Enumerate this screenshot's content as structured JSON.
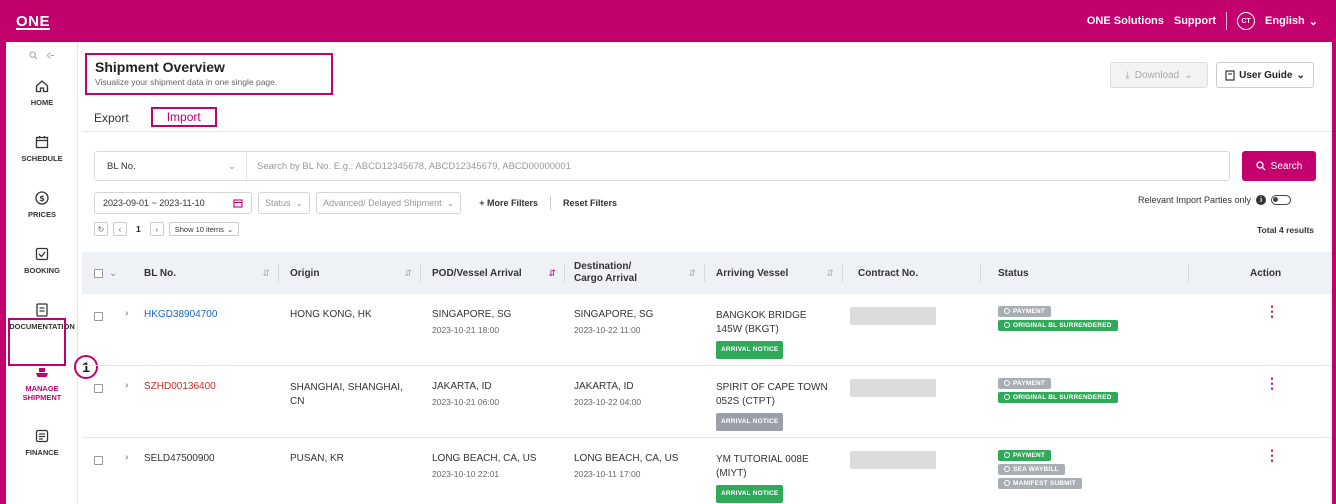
{
  "app": {
    "logo": "ONE",
    "top_links": {
      "solutions": "ONE Solutions",
      "support": "Support",
      "avatar": "CT",
      "language": "English"
    }
  },
  "sidebar": {
    "items": [
      {
        "label": "HOME",
        "icon": "home-icon"
      },
      {
        "label": "SCHEDULE",
        "icon": "calendar-icon"
      },
      {
        "label": "PRICES",
        "icon": "dollar-icon"
      },
      {
        "label": "BOOKING",
        "icon": "booking-icon"
      },
      {
        "label": "DOCUMENTATION",
        "icon": "document-icon"
      },
      {
        "label": "MANAGE SHIPMENT",
        "icon": "ship-icon",
        "active": true
      },
      {
        "label": "FINANCE",
        "icon": "finance-icon"
      }
    ],
    "step_marker": "1"
  },
  "header": {
    "title": "Shipment Overview",
    "subtitle": "Visualize your shipment data in one single page.",
    "download_label": "Download",
    "user_guide_label": "User Guide"
  },
  "tabs": [
    {
      "label": "Export"
    },
    {
      "label": "Import",
      "active": true
    }
  ],
  "search": {
    "field_select": "BL No.",
    "placeholder": "Search by BL No. E.g.: ABCD12345678, ABCD12345679, ABCD00000001",
    "button_label": "Search"
  },
  "filters": {
    "date_range": "2023-09-01 ~ 2023-11-10",
    "status": "Status",
    "advanced": "Advanced/ Delayed Shipment",
    "more_filters": "+ More Filters",
    "reset_filters": "Reset Filters",
    "relevant_toggle_label": "Relevant Import Parties only"
  },
  "pager": {
    "page": "1",
    "show_items": "Show 10 items",
    "total": "Total 4 results"
  },
  "table": {
    "columns": {
      "bl": "BL No.",
      "origin": "Origin",
      "pod": "POD/Vessel Arrival",
      "dest": "Destination/ Cargo Arrival",
      "vessel": "Arriving Vessel",
      "contract": "Contract No.",
      "status": "Status",
      "action": "Action"
    },
    "rows": [
      {
        "bl": "HKGD38904700",
        "bl_style": "link",
        "origin": "HONG KONG, HK",
        "pod": "SINGAPORE, SG",
        "pod_time": "2023-10-21  18:00",
        "dest": "SINGAPORE, SG",
        "dest_time": "2023-10-22  11:00",
        "vessel": "BANGKOK BRIDGE 145W (BKGT)",
        "vessel_chip": "ARRIVAL NOTICE",
        "statuses": [
          {
            "label": "PAYMENT",
            "color": "grey"
          },
          {
            "label": "ORIGINAL BL SURRENDERED",
            "color": "green"
          }
        ]
      },
      {
        "bl": "SZHD00136400",
        "bl_style": "red",
        "origin": "SHANGHAI, SHANGHAI, CN",
        "pod": "JAKARTA, ID",
        "pod_time": "2023-10-21  06:00",
        "dest": "JAKARTA, ID",
        "dest_time": "2023-10-22  04:00",
        "vessel": "SPIRIT OF CAPE TOWN 052S (CTPT)",
        "vessel_chip": "ARRIVAL NOTICE",
        "statuses": [
          {
            "label": "PAYMENT",
            "color": "grey"
          },
          {
            "label": "ORIGINAL BL SURRENDERED",
            "color": "green"
          }
        ]
      },
      {
        "bl": "SELD47500900",
        "bl_style": "plain",
        "origin": "PUSAN, KR",
        "pod": "LONG BEACH, CA, US",
        "pod_time": "2023-10-10  22:01",
        "dest": "LONG BEACH, CA, US",
        "dest_time": "2023-10-11  17:00",
        "vessel": "YM TUTORIAL 008E (MIYT)",
        "vessel_chip": "ARRIVAL NOTICE",
        "statuses": [
          {
            "label": "PAYMENT",
            "color": "green"
          },
          {
            "label": "SEA WAYBILL",
            "color": "grey"
          },
          {
            "label": "MANIFEST SUBMIT",
            "color": "grey"
          }
        ]
      }
    ]
  },
  "colors": {
    "brand": "#c2006e",
    "link": "#1a66c2",
    "alert": "#d62b2b",
    "success": "#2eaa58"
  }
}
